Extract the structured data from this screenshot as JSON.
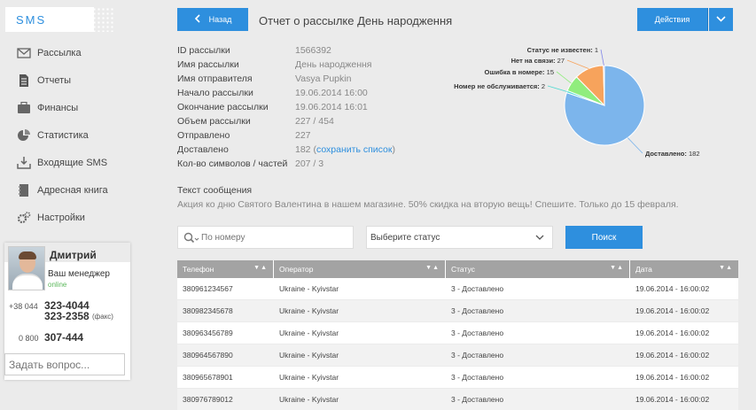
{
  "app": {
    "logo": "SMS"
  },
  "sidebar": {
    "items": [
      {
        "label": "Рассылка",
        "icon": "envelope-icon"
      },
      {
        "label": "Отчеты",
        "icon": "document-icon"
      },
      {
        "label": "Финансы",
        "icon": "briefcase-icon"
      },
      {
        "label": "Статистика",
        "icon": "pie-chart-icon"
      },
      {
        "label": "Входящие SMS",
        "icon": "inbox-download-icon"
      },
      {
        "label": "Адресная книга",
        "icon": "address-book-icon"
      },
      {
        "label": "Настройки",
        "icon": "gears-icon"
      }
    ]
  },
  "manager": {
    "name": "Дмитрий",
    "role": "Ваш менеджер",
    "status": "online",
    "prefix_city": "+38 044",
    "phone1": "323-4044",
    "phone2": "323-2358",
    "fax_note": "(факс)",
    "prefix_free": "0 800",
    "phone3": "307-444",
    "ask_placeholder": "Задать вопрос..."
  },
  "header": {
    "back_label": "Назад",
    "title": "Отчет о рассылке День народження",
    "actions_label": "Действия"
  },
  "info": [
    {
      "key": "ID рассылки",
      "value": "1566392"
    },
    {
      "key": "Имя рассылки",
      "value": "День народження"
    },
    {
      "key": "Имя отправителя",
      "value": "Vasya Pupkin",
      "link": true
    },
    {
      "key": "Начало рассылки",
      "value": "19.06.2014 16:00"
    },
    {
      "key": "Окончание рассылки",
      "value": "19.06.2014 16:01"
    },
    {
      "key": "Объем рассылки",
      "value": "227 / 454"
    },
    {
      "key": "Отправлено",
      "value": "227"
    },
    {
      "key": "Доставлено",
      "value": "182",
      "extra_pre": "(",
      "extra_link": "сохранить список",
      "extra_post": ")"
    },
    {
      "key": "Кол-во символов / частей",
      "value": "207 / 3"
    }
  ],
  "message": {
    "label": "Текст сообщения",
    "text": "Акция ко дню Святого Валентина в нашем магазине. 50% скидка на вторую вещь! Спешите. Только до 15 февраля."
  },
  "chart_data": {
    "type": "pie",
    "slices": [
      {
        "label": "Доставлено",
        "value": 182,
        "color": "#7cb5ec"
      },
      {
        "label": "Номер не обслуживается",
        "value": 2,
        "color": "#4dd9d0"
      },
      {
        "label": "Ошибка в номере",
        "value": 15,
        "color": "#90ed7d"
      },
      {
        "label": "Нет на связи",
        "value": 27,
        "color": "#f7a35c"
      },
      {
        "label": "Статус не известен",
        "value": 1,
        "color": "#8085e9"
      }
    ]
  },
  "filters": {
    "search_placeholder": "По номеру",
    "status_selected": "Выберите статус",
    "search_button": "Поиск"
  },
  "table": {
    "headers": [
      "Телефон",
      "Оператор",
      "Статус",
      "Дата"
    ],
    "sort_glyph": "▼▲",
    "rows": [
      [
        "380961234567",
        "Ukraine - Kyivstar",
        "3 - Доставлено",
        "19.06.2014 - 16:00:02"
      ],
      [
        "380982345678",
        "Ukraine - Kyivstar",
        "3 - Доставлено",
        "19.06.2014 - 16:00:02"
      ],
      [
        "380963456789",
        "Ukraine - Kyivstar",
        "3 - Доставлено",
        "19.06.2014 - 16:00:02"
      ],
      [
        "380964567890",
        "Ukraine - Kyivstar",
        "3 - Доставлено",
        "19.06.2014 - 16:00:02"
      ],
      [
        "380965678901",
        "Ukraine - Kyivstar",
        "3 - Доставлено",
        "19.06.2014 - 16:00:02"
      ],
      [
        "380976789012",
        "Ukraine - Kyivstar",
        "3 - Доставлено",
        "19.06.2014 - 16:00:02"
      ]
    ]
  },
  "colors": {
    "accent": "#2e8fde",
    "online": "#5cb85c",
    "table_header": "#a3a3a3"
  }
}
